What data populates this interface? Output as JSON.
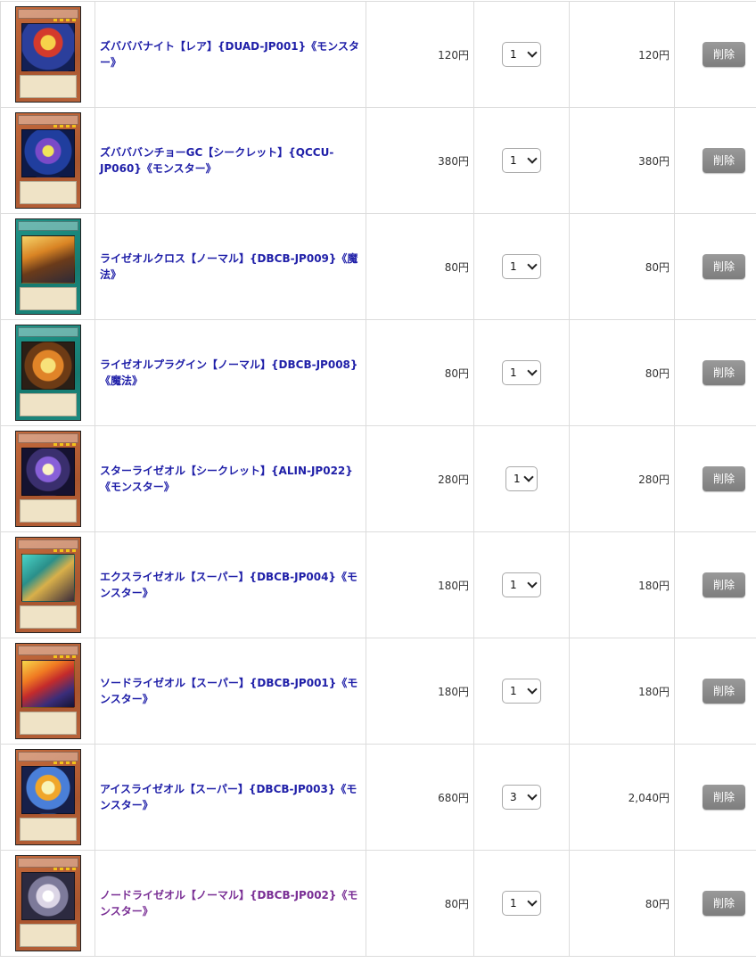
{
  "cart": {
    "rows": [
      {
        "name": "ズバババナイト【レア】{DUAD-JP001}《モンスター》",
        "price": "120円",
        "quantity": "1",
        "subtotal": "120円",
        "delete_label": "削除"
      },
      {
        "name": "ズバババンチョーGC【シークレット】{QCCU-JP060}《モンスター》",
        "price": "380円",
        "quantity": "1",
        "subtotal": "380円",
        "delete_label": "削除"
      },
      {
        "name": "ライゼオルクロス【ノーマル】{DBCB-JP009}《魔法》",
        "price": "80円",
        "quantity": "1",
        "subtotal": "80円",
        "delete_label": "削除"
      },
      {
        "name": "ライゼオルプラグイン【ノーマル】{DBCB-JP008}《魔法》",
        "price": "80円",
        "quantity": "1",
        "subtotal": "80円",
        "delete_label": "削除"
      },
      {
        "name": "スターライゼオル【シークレット】{ALIN-JP022}《モンスター》",
        "price": "280円",
        "quantity": "1",
        "subtotal": "280円",
        "delete_label": "削除"
      },
      {
        "name": "エクスライゼオル【スーパー】{DBCB-JP004}《モンスター》",
        "price": "180円",
        "quantity": "1",
        "subtotal": "180円",
        "delete_label": "削除"
      },
      {
        "name": "ソードライゼオル【スーパー】{DBCB-JP001}《モンスター》",
        "price": "180円",
        "quantity": "1",
        "subtotal": "180円",
        "delete_label": "削除"
      },
      {
        "name": "アイスライゼオル【スーパー】{DBCB-JP003}《モンスター》",
        "price": "680円",
        "quantity": "3",
        "subtotal": "2,040円",
        "delete_label": "削除"
      },
      {
        "name": "ノードライゼオル【ノーマル】{DBCB-JP002}《モンスター》",
        "price": "80円",
        "quantity": "1",
        "subtotal": "80円",
        "delete_label": "削除"
      }
    ]
  },
  "colors": {
    "link": "#1f1fa8",
    "visited_link": "#7a2f95",
    "delete_button": "#8a8a8a",
    "border": "#dcdcdc"
  },
  "icons": {
    "quantity_dropdown": "chevron-down-icon"
  }
}
